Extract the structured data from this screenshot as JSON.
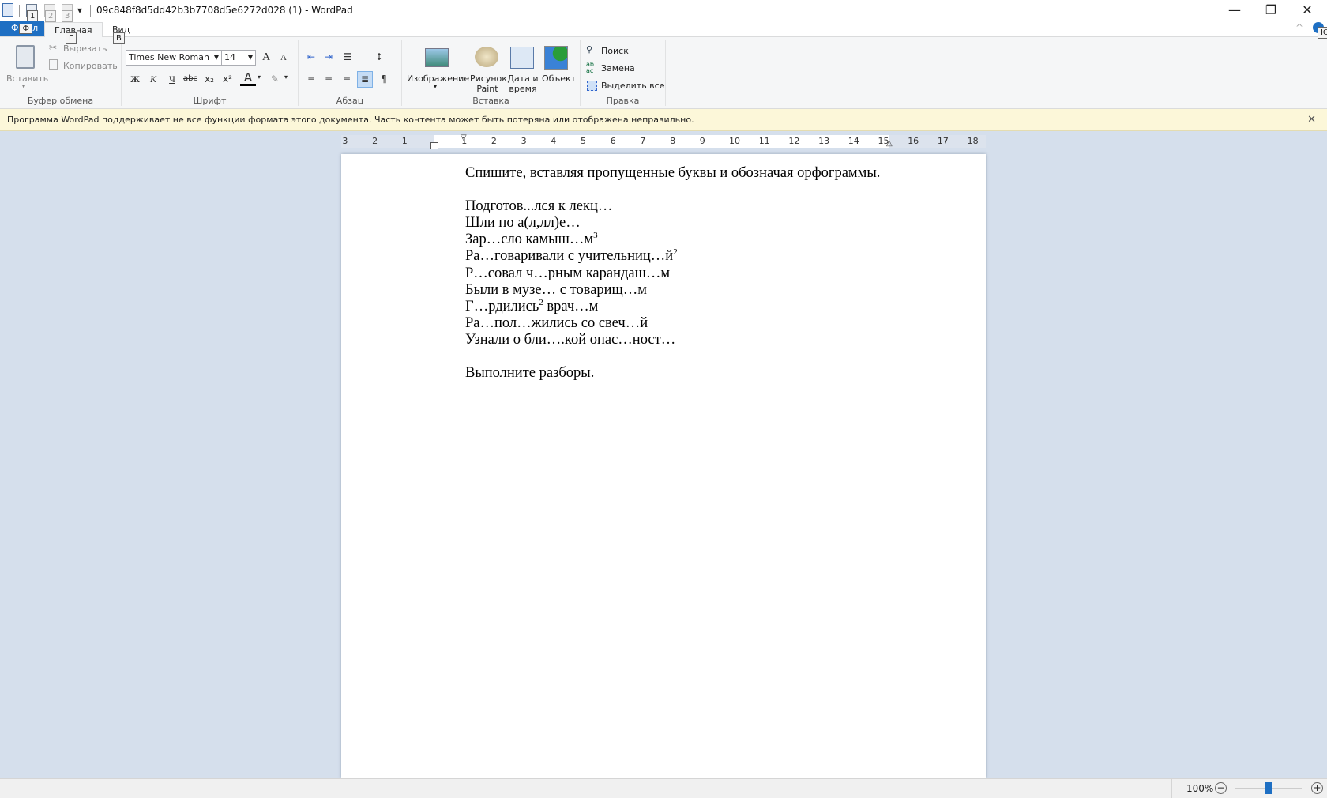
{
  "window": {
    "title": "09c848f8d5dd42b3b7708d5e6272d028 (1) - WordPad",
    "minimize": "—",
    "restore": "❐",
    "close": "✕"
  },
  "quick_access": {
    "keytips": [
      "1",
      "2",
      "3"
    ],
    "dropdown": "▾"
  },
  "tabs": {
    "file": "Ф",
    "file_keytip": "Ф",
    "file_suffix": "л",
    "home": "Главная",
    "home_keytip": "Г",
    "view": "Вид",
    "view_keytip": "В",
    "help_keytip": "Ю",
    "collapse": "^"
  },
  "ribbon": {
    "clipboard": {
      "label": "Буфер обмена",
      "paste": "Вставить",
      "cut": "Вырезать",
      "copy": "Копировать"
    },
    "font": {
      "label": "Шрифт",
      "family": "Times New Roman",
      "size": "14",
      "bold": "Ж",
      "italic": "К",
      "underline": "Ч",
      "strike": "abc",
      "sub": "x₂",
      "sup": "x²",
      "color": "A"
    },
    "paragraph": {
      "label": "Абзац"
    },
    "insert": {
      "label": "Вставка",
      "image": "Изображение",
      "paint": "Рисунок Paint",
      "datetime": "Дата и время",
      "object": "Объект"
    },
    "edit": {
      "label": "Правка",
      "find": "Поиск",
      "replace": "Замена",
      "select_all": "Выделить все"
    }
  },
  "infobar": {
    "message": "Программа WordPad поддерживает не все функции формата этого документа. Часть контента может быть потеряна или отображена неправильно.",
    "close": "✕"
  },
  "ruler": {
    "labels": [
      "3",
      "2",
      "1",
      "1",
      "2",
      "3",
      "4",
      "5",
      "6",
      "7",
      "8",
      "9",
      "10",
      "11",
      "12",
      "13",
      "14",
      "15",
      "16",
      "17",
      "18"
    ]
  },
  "document": {
    "instruction": "Спишите, вставляя пропущенные буквы и обозначая орфограммы.",
    "lines": [
      {
        "text": "Подготов...лся к лекц…"
      },
      {
        "text": "Шли по а(л,лл)е…"
      },
      {
        "text": "Зар…сло камыш…м",
        "sup": "3"
      },
      {
        "text": "Ра…говаривали с учительниц…й",
        "sup": "2"
      },
      {
        "text": "Р…совал ч…рным карандаш…м"
      },
      {
        "text": "Были в музе… с товарищ…м"
      },
      {
        "text": "Г…рдились",
        "sup": "2",
        "tail": " врач…м"
      },
      {
        "text": "Ра…пол…жились со свеч…й"
      },
      {
        "text": "Узнали о бли….кой опас…ност…"
      }
    ],
    "final": "Выполните разборы."
  },
  "status": {
    "zoom": "100%",
    "zoom_fraction": 0.5,
    "zoom_out": "−",
    "zoom_in": "+"
  }
}
